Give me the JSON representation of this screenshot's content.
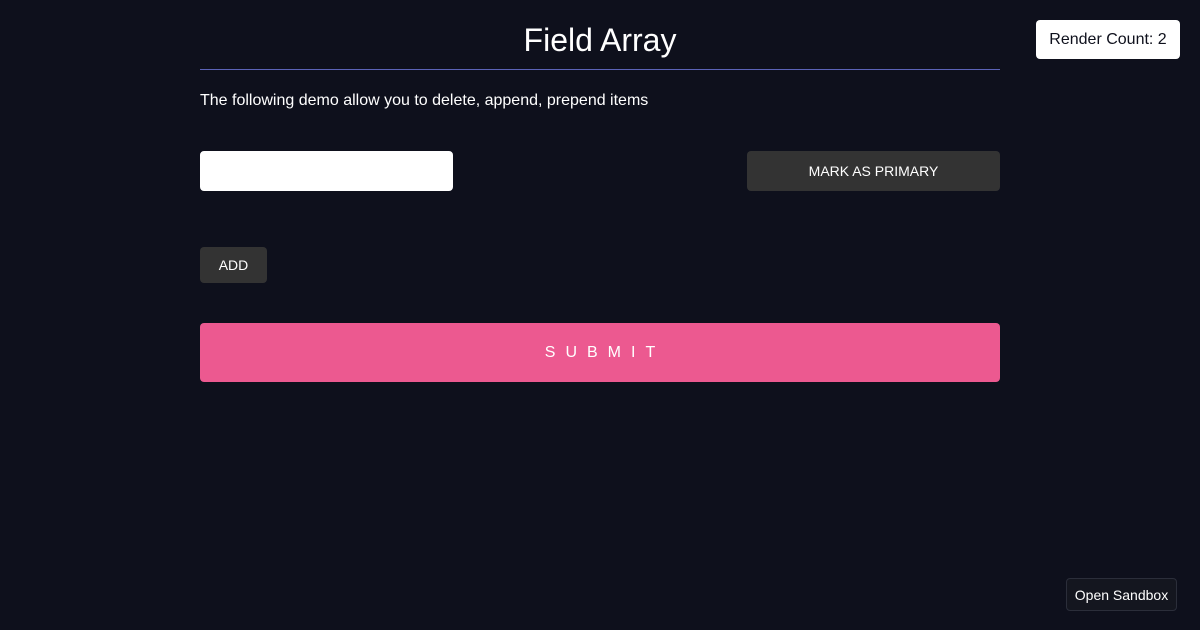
{
  "header": {
    "title": "Field Array",
    "render_count": "Render Count: 2"
  },
  "main": {
    "description": "The following demo allow you to delete, append, prepend items",
    "field": {
      "value": "",
      "placeholder": ""
    },
    "mark_primary_label": "MARK AS PRIMARY",
    "add_label": "ADD",
    "submit_label": "SUBMIT"
  },
  "footer": {
    "sandbox_label": "Open Sandbox"
  },
  "colors": {
    "background": "#0e101c",
    "accent": "#ec5990",
    "button_dark": "#333333",
    "divider": "#5b63b7"
  }
}
